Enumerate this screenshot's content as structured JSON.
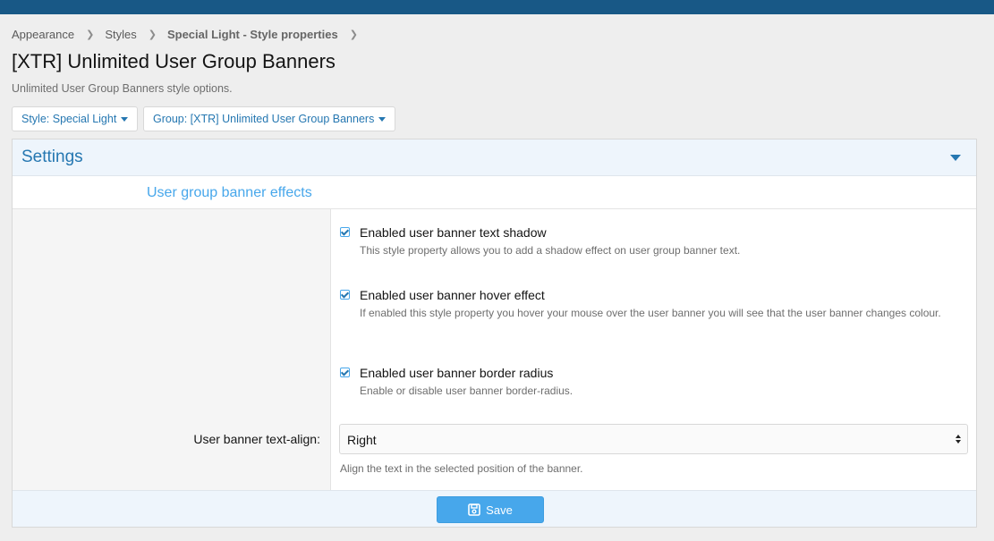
{
  "breadcrumb": {
    "items": [
      "Appearance",
      "Styles",
      "Special Light - Style properties"
    ]
  },
  "page": {
    "title": "[XTR] Unlimited User Group Banners",
    "description": "Unlimited User Group Banners style options."
  },
  "filters": {
    "style_label": "Style: Special Light",
    "group_label": "Group: [XTR] Unlimited User Group Banners"
  },
  "block": {
    "title": "Settings",
    "section_title": "User group banner effects"
  },
  "options": [
    {
      "label": "Enabled user banner text shadow",
      "hint": "This style property allows you to add a shadow effect on user group banner text.",
      "checked": true
    },
    {
      "label": "Enabled user banner hover effect",
      "hint": "If enabled this style property you hover your mouse over the user banner you will see that the user banner changes colour.",
      "checked": true
    },
    {
      "label": "Enabled user banner border radius",
      "hint": "Enable or disable user banner border-radius.",
      "checked": true
    }
  ],
  "text_align": {
    "label": "User banner text-align:",
    "value": "Right",
    "hint": "Align the text in the selected position of the banner."
  },
  "footer": {
    "save_label": "Save"
  },
  "colors": {
    "topbar": "#185886",
    "accent": "#2577b1",
    "button": "#47a7eb"
  }
}
